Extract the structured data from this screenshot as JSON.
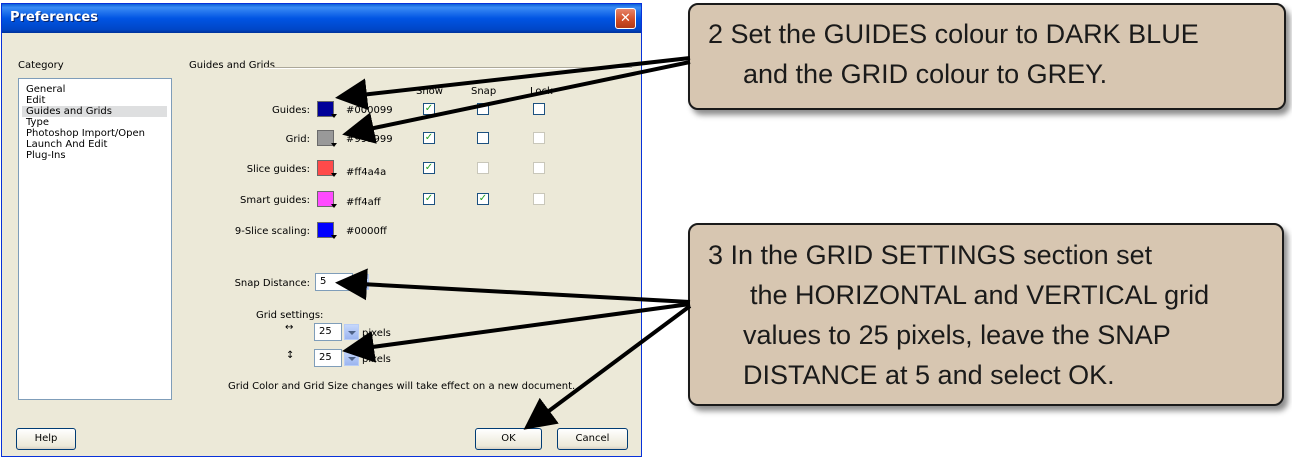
{
  "dialog": {
    "title": "Preferences",
    "close_glyph": "✕",
    "category_label": "Category",
    "categories": [
      "General",
      "Edit",
      "Guides and Grids",
      "Type",
      "Photoshop Import/Open",
      "Launch And Edit",
      "Plug-Ins"
    ],
    "selected_category": "Guides and Grids",
    "section_title": "Guides and Grids",
    "columns": {
      "show": "Show",
      "snap": "Snap",
      "lock": "Lock"
    },
    "rows": [
      {
        "label": "Guides:",
        "color": "#000099",
        "hex": "#000099",
        "show": true,
        "snap": false,
        "lock": false
      },
      {
        "label": "Grid:",
        "color": "#999999",
        "hex": "#999999",
        "show": true,
        "snap": false,
        "lock": null
      },
      {
        "label": "Slice guides:",
        "color": "#ff4a4a",
        "hex": "#ff4a4a",
        "show": true,
        "snap": null,
        "lock": null
      },
      {
        "label": "Smart guides:",
        "color": "#ff4aff",
        "hex": "#ff4aff",
        "show": true,
        "snap": true,
        "lock": null
      },
      {
        "label": "9-Slice scaling:",
        "color": "#0000ff",
        "hex": "#0000ff"
      }
    ],
    "snap_distance": {
      "label": "Snap Distance:",
      "value": "5"
    },
    "grid_settings": {
      "label": "Grid settings:",
      "horizontal": {
        "icon": "↔",
        "value": "25",
        "unit": "pixels"
      },
      "vertical": {
        "icon": "↕",
        "value": "25",
        "unit": "pixels"
      }
    },
    "note": "Grid Color and Grid Size changes will take effect on a new document.",
    "buttons": {
      "help": "Help",
      "ok": "OK",
      "cancel": "Cancel"
    }
  },
  "callouts": {
    "step2": [
      "2  Set the GUIDES colour to DARK BLUE",
      "and the GRID colour to GREY."
    ],
    "step3": [
      "3  In the GRID SETTINGS section set",
      "the HORIZONTAL and VERTICAL grid",
      "values to 25 pixels, leave the SNAP",
      "DISTANCE at 5 and select OK."
    ]
  }
}
